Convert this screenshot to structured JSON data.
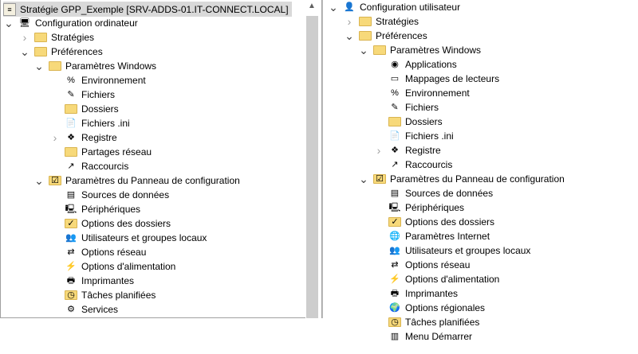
{
  "left_tree": {
    "title": "Stratégie GPP_Exemple [SRV-ADDS-01.IT-CONNECT.LOCAL]",
    "items": [
      {
        "label": "Configuration ordinateur",
        "level": 0,
        "state": "open",
        "icon": "computer-icon"
      },
      {
        "label": "Stratégies",
        "level": 1,
        "state": "closed",
        "icon": "folder-icon"
      },
      {
        "label": "Préférences",
        "level": 1,
        "state": "open",
        "icon": "folder-icon"
      },
      {
        "label": "Paramètres Windows",
        "level": 2,
        "state": "open",
        "icon": "folder-icon"
      },
      {
        "label": "Environnement",
        "level": 3,
        "icon": "environment-icon"
      },
      {
        "label": "Fichiers",
        "level": 3,
        "icon": "files-icon"
      },
      {
        "label": "Dossiers",
        "level": 3,
        "icon": "folders-icon"
      },
      {
        "label": "Fichiers .ini",
        "level": 3,
        "icon": "ini-file-icon"
      },
      {
        "label": "Registre",
        "level": 3,
        "state": "closed",
        "icon": "registry-icon"
      },
      {
        "label": "Partages réseau",
        "level": 3,
        "icon": "network-share-icon"
      },
      {
        "label": "Raccourcis",
        "level": 3,
        "icon": "shortcut-icon"
      },
      {
        "label": "Paramètres du Panneau de configuration",
        "level": 2,
        "state": "open",
        "icon": "control-panel-icon"
      },
      {
        "label": "Sources de données",
        "level": 3,
        "icon": "data-sources-icon"
      },
      {
        "label": "Périphériques",
        "level": 3,
        "icon": "devices-icon"
      },
      {
        "label": "Options des dossiers",
        "level": 3,
        "icon": "folder-options-icon"
      },
      {
        "label": "Utilisateurs et groupes locaux",
        "level": 3,
        "icon": "local-users-icon"
      },
      {
        "label": "Options réseau",
        "level": 3,
        "icon": "network-options-icon"
      },
      {
        "label": "Options d'alimentation",
        "level": 3,
        "icon": "power-options-icon"
      },
      {
        "label": "Imprimantes",
        "level": 3,
        "icon": "printer-icon"
      },
      {
        "label": "Tâches planifiées",
        "level": 3,
        "icon": "scheduled-tasks-icon"
      },
      {
        "label": "Services",
        "level": 3,
        "icon": "services-icon"
      }
    ]
  },
  "right_tree": {
    "items": [
      {
        "label": "Configuration utilisateur",
        "level": 0,
        "state": "open",
        "icon": "user-icon"
      },
      {
        "label": "Stratégies",
        "level": 1,
        "state": "closed",
        "icon": "folder-icon"
      },
      {
        "label": "Préférences",
        "level": 1,
        "state": "open",
        "icon": "folder-icon"
      },
      {
        "label": "Paramètres Windows",
        "level": 2,
        "state": "open",
        "icon": "folder-icon"
      },
      {
        "label": "Applications",
        "level": 3,
        "icon": "applications-icon"
      },
      {
        "label": "Mappages de lecteurs",
        "level": 3,
        "icon": "drive-maps-icon"
      },
      {
        "label": "Environnement",
        "level": 3,
        "icon": "environment-icon"
      },
      {
        "label": "Fichiers",
        "level": 3,
        "icon": "files-icon"
      },
      {
        "label": "Dossiers",
        "level": 3,
        "icon": "folders-icon"
      },
      {
        "label": "Fichiers .ini",
        "level": 3,
        "icon": "ini-file-icon"
      },
      {
        "label": "Registre",
        "level": 3,
        "state": "closed",
        "icon": "registry-icon"
      },
      {
        "label": "Raccourcis",
        "level": 3,
        "icon": "shortcut-icon"
      },
      {
        "label": "Paramètres du Panneau de configuration",
        "level": 2,
        "state": "open",
        "icon": "control-panel-icon"
      },
      {
        "label": "Sources de données",
        "level": 3,
        "icon": "data-sources-icon"
      },
      {
        "label": "Périphériques",
        "level": 3,
        "icon": "devices-icon"
      },
      {
        "label": "Options des dossiers",
        "level": 3,
        "icon": "folder-options-icon"
      },
      {
        "label": "Paramètres Internet",
        "level": 3,
        "icon": "internet-settings-icon"
      },
      {
        "label": "Utilisateurs et groupes locaux",
        "level": 3,
        "icon": "local-users-icon"
      },
      {
        "label": "Options réseau",
        "level": 3,
        "icon": "network-options-icon"
      },
      {
        "label": "Options d'alimentation",
        "level": 3,
        "icon": "power-options-icon"
      },
      {
        "label": "Imprimantes",
        "level": 3,
        "icon": "printer-icon"
      },
      {
        "label": "Options régionales",
        "level": 3,
        "icon": "regional-options-icon"
      },
      {
        "label": "Tâches planifiées",
        "level": 3,
        "icon": "scheduled-tasks-icon"
      },
      {
        "label": "Menu Démarrer",
        "level": 3,
        "icon": "start-menu-icon"
      }
    ]
  }
}
